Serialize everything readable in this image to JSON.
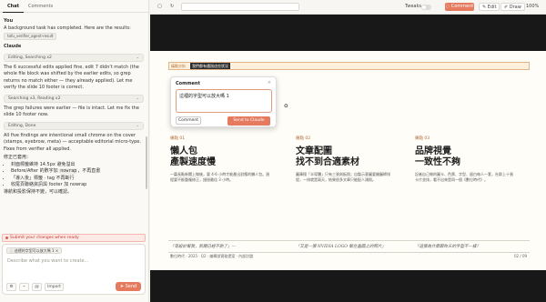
{
  "left_panel": {
    "tabs": [
      "Chat",
      "Comments"
    ],
    "messages": {
      "you_label": "You",
      "you_text": "A background task has completed. Here are the results:",
      "you_chip": "tofu_verifier_agent-result",
      "claude_label": "Claude",
      "tool1": "Editing, Searching x2",
      "para1": "The 6 successful edits applied fine, edit 7 didn't match (the whole file block was shifted by the earlier edits, so grep returns no match either — they already applied). Let me verify the slide 10 footer is correct.",
      "tool2": "Searching x3, Reading x2",
      "para2": "The grep failures were earlier — file is intact. Let me fix the slide 10 footer now.",
      "tool3": "Editing, Done",
      "para3": "All five findings are intentional small chrome on the cover (stamps, eyebrow, meta) — acceptable editorial micro-type. Fixes from verifier all applied.",
      "fix_header": "修正已套用：",
      "fix_items": [
        {
          "before": "封面標籤維持 14.5px 避免溢出",
          "code": "",
          "after": ""
        },
        {
          "before": "Before/After 的數字加 ",
          "code": "nowrap",
          "after": "，不再直書"
        },
        {
          "before": "「導入後」標籤 · tag 不再斷行",
          "code": "",
          "after": ""
        },
        {
          "before": "收尾頁聯絡資訊與 footer 加 nowrap",
          "code": "",
          "after": ""
        }
      ],
      "trailing": "導航和投影保持不變，可以確認。"
    },
    "submit_bar": "Submit your changes when ready",
    "compose": {
      "attachment": "這裡的字型可以放大嗎 1",
      "placeholder": "Describe what you want to create...",
      "import_label": "Import",
      "send_label": "Send"
    }
  },
  "toolbar": {
    "tweaks_label": "Tweaks",
    "comment_label": "Comment",
    "edit_label": "Edit",
    "draw_label": "Draw",
    "zoom": "100%"
  },
  "slide": {
    "tag1": "痛點分析",
    "tag2": "我們都有遇過這些狀況",
    "headline_fragment": "月，",
    "headline_fragment2": "。",
    "columns": [
      {
        "num": "痛點 01",
        "title1": "懶人包",
        "title2": "產製速度慢",
        "body": "一篇長點新聞上線後，要 4-6 小時才能產出對應的懶人包。過程要不斷重複修正，錯過最佳 3 小時。"
      },
      {
        "num": "痛點 02",
        "title1": "文章配圖",
        "title2": "找不到合適素材",
        "body": "圖庫搜「半導體」只有三張刻板照；自製示意圖要繪圖師排程，一排就是兩天，結果很多文章只能配人頭照。"
      },
      {
        "num": "痛點 03",
        "title1": "品牌視覺",
        "title2": "一致性不夠",
        "body": "記者自己做的圖卡、色票、字型、留白每人一套，社群上十張卡片並排，看不出來是同一個《數位時代》。"
      }
    ],
    "quotes": [
      "「等設計幫我，新聞已經不熱了」—",
      "「又是一張 NVIDIA LOGO 幫在晶圓上的照片」",
      "「這張為什麼跟昨天的字型不一樣？"
    ],
    "footer_left": "數位時代 · 2025 · Q2 · 編輯部實務提案 · 內部討論",
    "footer_right": "02 / 09"
  },
  "comment_popup": {
    "title": "Comment",
    "text": "這裡的字型可以放大嗎 1",
    "comment_btn": "Comment",
    "send_btn": "Send to Claude"
  },
  "colors": {
    "accent": "#e57a5f",
    "tag": "#b4713a",
    "dark": "#181818"
  }
}
